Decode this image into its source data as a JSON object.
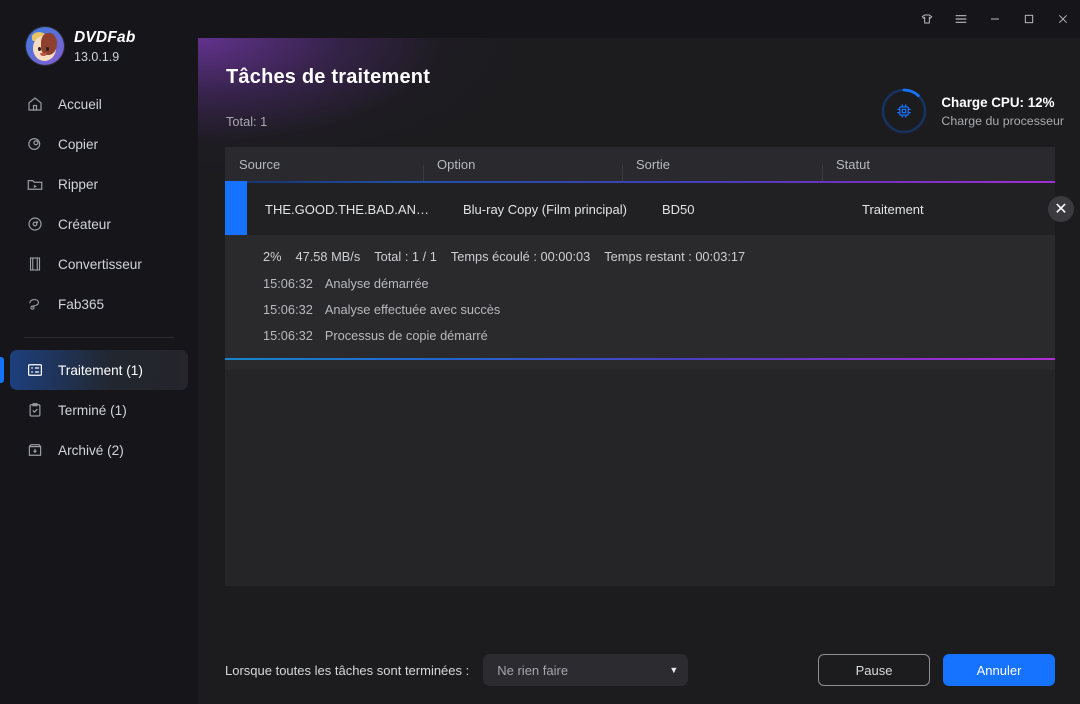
{
  "titlebar": {
    "buttons": [
      {
        "name": "theme-icon",
        "label": "Thème"
      },
      {
        "name": "menu-icon",
        "label": "Menu"
      },
      {
        "name": "minimize-icon",
        "label": "Réduire"
      },
      {
        "name": "maximize-icon",
        "label": "Agrandir"
      },
      {
        "name": "close-icon",
        "label": "Fermer"
      }
    ]
  },
  "sidebar": {
    "brand_name": "DVDFab",
    "version": "13.0.1.9",
    "items": [
      {
        "label": "Accueil",
        "icon": "home-icon",
        "active": false
      },
      {
        "label": "Copier",
        "icon": "disc-copy-icon",
        "active": false
      },
      {
        "label": "Ripper",
        "icon": "folder-play-icon",
        "active": false
      },
      {
        "label": "Créateur",
        "icon": "disc-icon",
        "active": false
      },
      {
        "label": "Convertisseur",
        "icon": "film-strip-icon",
        "active": false
      },
      {
        "label": "Fab365",
        "icon": "fab365-icon",
        "active": false
      }
    ],
    "items_lower": [
      {
        "label": "Traitement (1)",
        "icon": "task-list-icon",
        "active": true
      },
      {
        "label": "Terminé (1)",
        "icon": "clipboard-check-icon",
        "active": false
      },
      {
        "label": "Archivé (2)",
        "icon": "archive-box-icon",
        "active": false
      }
    ]
  },
  "page": {
    "title": "Tâches de traitement",
    "total": "Total: 1"
  },
  "cpu": {
    "title": "Charge CPU: 12%",
    "subtitle": "Charge du processeur",
    "percent": 12,
    "accent": "#1573ff",
    "track": "#16335e",
    "icon": "cpu-chip-icon"
  },
  "table": {
    "columns": [
      "Source",
      "Option",
      "Sortie",
      "Statut"
    ],
    "rows": [
      {
        "source": "THE.GOOD.THE.BAD.AN…",
        "option": "Blu-ray Copy (Film principal)",
        "sortie": "BD50",
        "statut": "Traitement",
        "cancel_glyph": "✕",
        "more_glyph": "⋮",
        "progress_percent": 2
      }
    ]
  },
  "detail": {
    "stats": [
      "2%",
      "47.58 MB/s",
      "Total : 1 / 1",
      "Temps écoulé : 00:00:03",
      "Temps restant : 00:03:17"
    ],
    "logs": [
      {
        "time": "15:06:32",
        "message": "Analyse démarrée"
      },
      {
        "time": "15:06:32",
        "message": "Analyse effectuée avec succès"
      },
      {
        "time": "15:06:32",
        "message": "Processus de copie démarré"
      }
    ]
  },
  "bottom": {
    "label": "Lorsque toutes les tâches sont terminées :",
    "select_value": "Ne rien faire",
    "select_chevron": "▼",
    "pause_label": "Pause",
    "cancel_label": "Annuler",
    "primary_color": "#1573ff"
  }
}
